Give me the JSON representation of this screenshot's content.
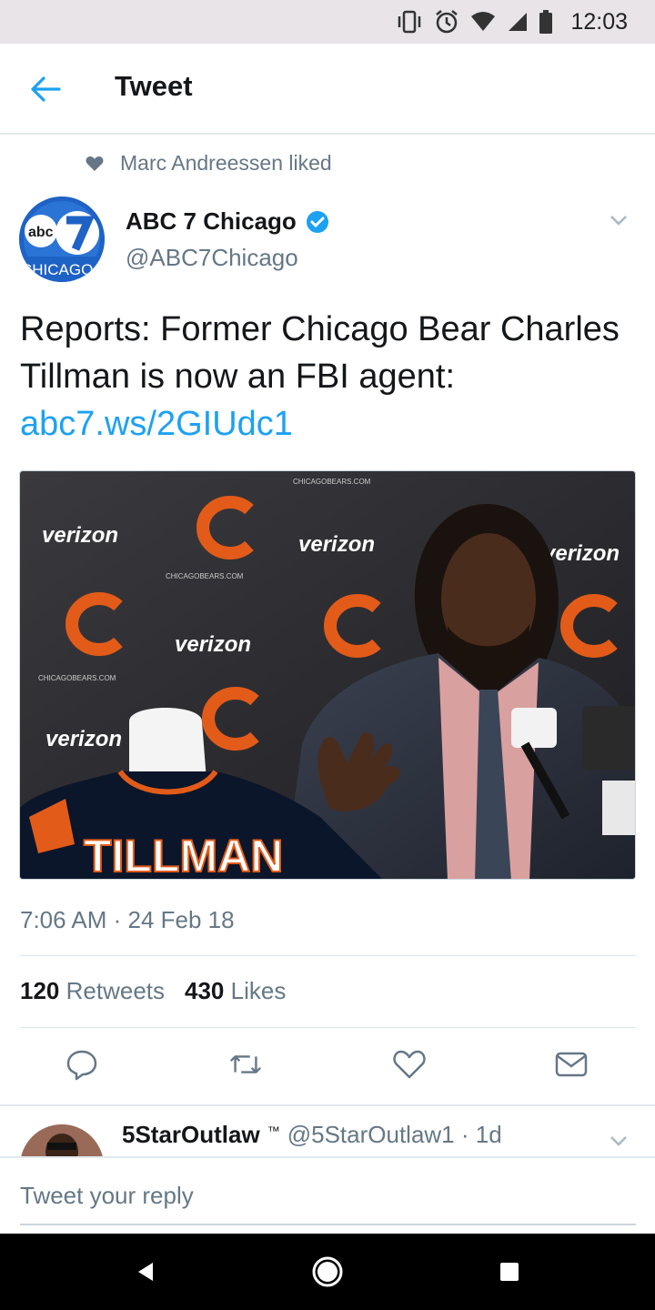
{
  "status_bar": {
    "time": "12:03",
    "icons": [
      "vibrate-icon",
      "alarm-icon",
      "wifi-icon",
      "signal-icon",
      "battery-icon"
    ]
  },
  "header": {
    "back_icon": "arrow-left-icon",
    "title": "Tweet"
  },
  "social_context": {
    "icon": "heart-icon",
    "text": "Marc Andreessen liked"
  },
  "author": {
    "name": "ABC 7 Chicago",
    "handle": "@ABC7Chicago",
    "verified": true,
    "avatar_logo_text": "abc 7 CHICAGO"
  },
  "tweet": {
    "text": "Reports: Former Chicago Bear Charles Tillman is now an FBI agent: ",
    "link": "abc7.ws/2GIUdc1",
    "timestamp": "7:06 AM · 24 Feb 18"
  },
  "photo": {
    "description_icon": "photo-press-conference",
    "jersey_text": "TILLMAN",
    "sponsor_text": "verizon",
    "backdrop_text": "CHICAGOBEARS.COM"
  },
  "stats": {
    "retweets_count": "120",
    "retweets_label": "Retweets",
    "likes_count": "430",
    "likes_label": "Likes"
  },
  "actions": [
    "reply-icon",
    "retweet-icon",
    "like-icon",
    "message-icon"
  ],
  "reply": {
    "name": "5StarOutlaw",
    "tm": "™",
    "handle_time": "@5StarOutlaw1 · 1d"
  },
  "composer": {
    "placeholder": "Tweet your reply"
  },
  "colors": {
    "accent": "#1da1f2",
    "text": "#14171a",
    "secondary": "#657786",
    "bears_orange": "#e35b19",
    "bears_navy": "#0b162a"
  }
}
